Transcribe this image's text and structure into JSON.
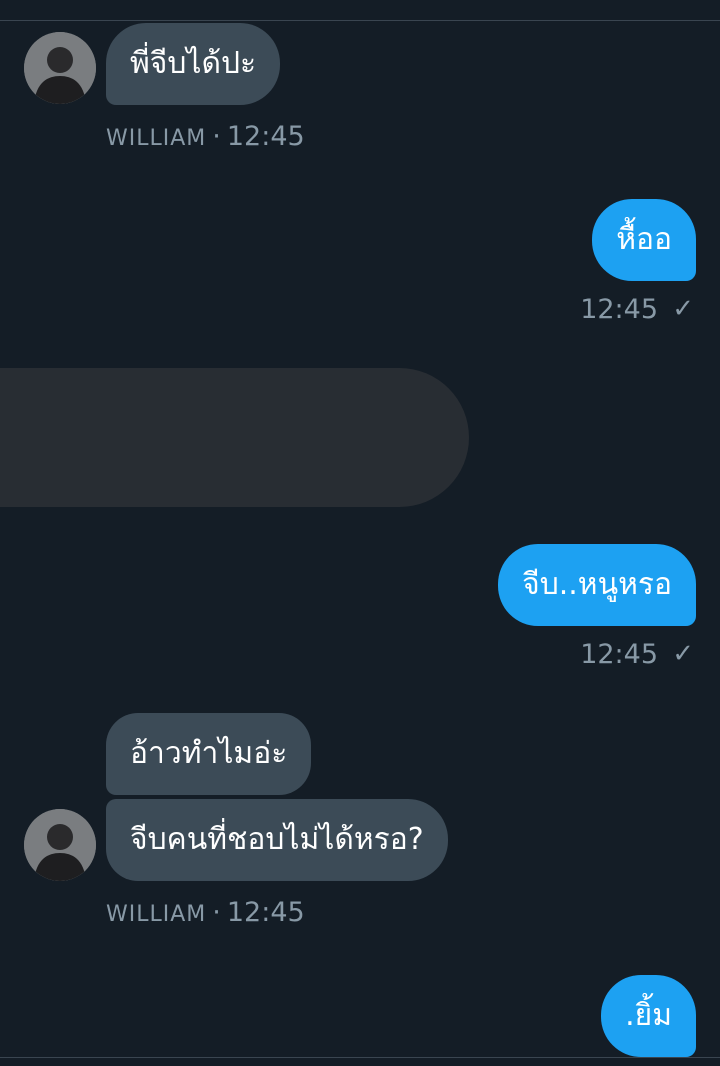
{
  "conversation": {
    "contact_name": "WILLIAM",
    "messages": [
      {
        "from": "contact",
        "text": "พี่จีบได้ปะ"
      },
      {
        "from": "contact_meta",
        "time": "12:45"
      },
      {
        "from": "me",
        "text": "หื้ออ",
        "time": "12:45",
        "status": "✓"
      },
      {
        "from": "me",
        "text": "จีบ..หนูหรอ",
        "time": "12:45",
        "status": "✓"
      },
      {
        "from": "contact",
        "text": "อ้าวทำไมอ่ะ"
      },
      {
        "from": "contact",
        "text": "จีบคนที่ชอบไม่ได้หรอ?"
      },
      {
        "from": "contact_meta",
        "time": "12:45"
      },
      {
        "from": "me",
        "text": ".ยิ้ม"
      }
    ]
  },
  "colors": {
    "background": "#141d26",
    "received_bubble": "#3c4b57",
    "sent_bubble": "#1da1f2",
    "meta_text": "#8899a6"
  }
}
